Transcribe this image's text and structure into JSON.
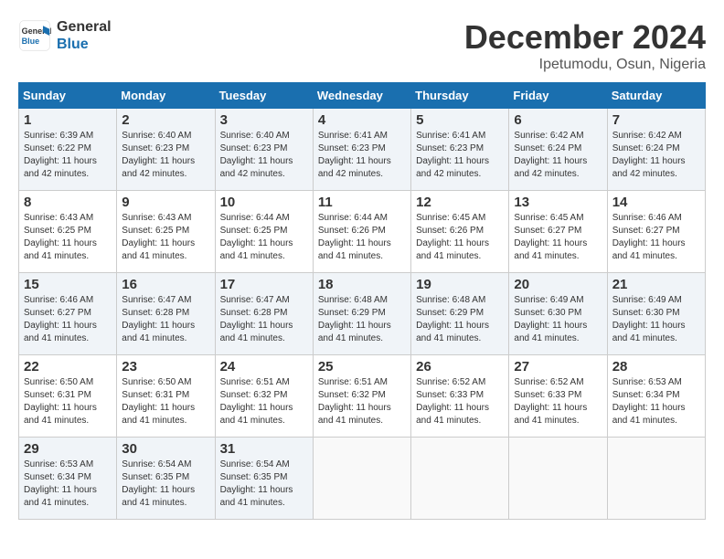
{
  "header": {
    "logo_line1": "General",
    "logo_line2": "Blue",
    "month": "December 2024",
    "location": "Ipetumodu, Osun, Nigeria"
  },
  "days_of_week": [
    "Sunday",
    "Monday",
    "Tuesday",
    "Wednesday",
    "Thursday",
    "Friday",
    "Saturday"
  ],
  "weeks": [
    [
      {
        "day": "1",
        "info": "Sunrise: 6:39 AM\nSunset: 6:22 PM\nDaylight: 11 hours\nand 42 minutes."
      },
      {
        "day": "2",
        "info": "Sunrise: 6:40 AM\nSunset: 6:23 PM\nDaylight: 11 hours\nand 42 minutes."
      },
      {
        "day": "3",
        "info": "Sunrise: 6:40 AM\nSunset: 6:23 PM\nDaylight: 11 hours\nand 42 minutes."
      },
      {
        "day": "4",
        "info": "Sunrise: 6:41 AM\nSunset: 6:23 PM\nDaylight: 11 hours\nand 42 minutes."
      },
      {
        "day": "5",
        "info": "Sunrise: 6:41 AM\nSunset: 6:23 PM\nDaylight: 11 hours\nand 42 minutes."
      },
      {
        "day": "6",
        "info": "Sunrise: 6:42 AM\nSunset: 6:24 PM\nDaylight: 11 hours\nand 42 minutes."
      },
      {
        "day": "7",
        "info": "Sunrise: 6:42 AM\nSunset: 6:24 PM\nDaylight: 11 hours\nand 42 minutes."
      }
    ],
    [
      {
        "day": "8",
        "info": "Sunrise: 6:43 AM\nSunset: 6:25 PM\nDaylight: 11 hours\nand 41 minutes."
      },
      {
        "day": "9",
        "info": "Sunrise: 6:43 AM\nSunset: 6:25 PM\nDaylight: 11 hours\nand 41 minutes."
      },
      {
        "day": "10",
        "info": "Sunrise: 6:44 AM\nSunset: 6:25 PM\nDaylight: 11 hours\nand 41 minutes."
      },
      {
        "day": "11",
        "info": "Sunrise: 6:44 AM\nSunset: 6:26 PM\nDaylight: 11 hours\nand 41 minutes."
      },
      {
        "day": "12",
        "info": "Sunrise: 6:45 AM\nSunset: 6:26 PM\nDaylight: 11 hours\nand 41 minutes."
      },
      {
        "day": "13",
        "info": "Sunrise: 6:45 AM\nSunset: 6:27 PM\nDaylight: 11 hours\nand 41 minutes."
      },
      {
        "day": "14",
        "info": "Sunrise: 6:46 AM\nSunset: 6:27 PM\nDaylight: 11 hours\nand 41 minutes."
      }
    ],
    [
      {
        "day": "15",
        "info": "Sunrise: 6:46 AM\nSunset: 6:27 PM\nDaylight: 11 hours\nand 41 minutes."
      },
      {
        "day": "16",
        "info": "Sunrise: 6:47 AM\nSunset: 6:28 PM\nDaylight: 11 hours\nand 41 minutes."
      },
      {
        "day": "17",
        "info": "Sunrise: 6:47 AM\nSunset: 6:28 PM\nDaylight: 11 hours\nand 41 minutes."
      },
      {
        "day": "18",
        "info": "Sunrise: 6:48 AM\nSunset: 6:29 PM\nDaylight: 11 hours\nand 41 minutes."
      },
      {
        "day": "19",
        "info": "Sunrise: 6:48 AM\nSunset: 6:29 PM\nDaylight: 11 hours\nand 41 minutes."
      },
      {
        "day": "20",
        "info": "Sunrise: 6:49 AM\nSunset: 6:30 PM\nDaylight: 11 hours\nand 41 minutes."
      },
      {
        "day": "21",
        "info": "Sunrise: 6:49 AM\nSunset: 6:30 PM\nDaylight: 11 hours\nand 41 minutes."
      }
    ],
    [
      {
        "day": "22",
        "info": "Sunrise: 6:50 AM\nSunset: 6:31 PM\nDaylight: 11 hours\nand 41 minutes."
      },
      {
        "day": "23",
        "info": "Sunrise: 6:50 AM\nSunset: 6:31 PM\nDaylight: 11 hours\nand 41 minutes."
      },
      {
        "day": "24",
        "info": "Sunrise: 6:51 AM\nSunset: 6:32 PM\nDaylight: 11 hours\nand 41 minutes."
      },
      {
        "day": "25",
        "info": "Sunrise: 6:51 AM\nSunset: 6:32 PM\nDaylight: 11 hours\nand 41 minutes."
      },
      {
        "day": "26",
        "info": "Sunrise: 6:52 AM\nSunset: 6:33 PM\nDaylight: 11 hours\nand 41 minutes."
      },
      {
        "day": "27",
        "info": "Sunrise: 6:52 AM\nSunset: 6:33 PM\nDaylight: 11 hours\nand 41 minutes."
      },
      {
        "day": "28",
        "info": "Sunrise: 6:53 AM\nSunset: 6:34 PM\nDaylight: 11 hours\nand 41 minutes."
      }
    ],
    [
      {
        "day": "29",
        "info": "Sunrise: 6:53 AM\nSunset: 6:34 PM\nDaylight: 11 hours\nand 41 minutes."
      },
      {
        "day": "30",
        "info": "Sunrise: 6:54 AM\nSunset: 6:35 PM\nDaylight: 11 hours\nand 41 minutes."
      },
      {
        "day": "31",
        "info": "Sunrise: 6:54 AM\nSunset: 6:35 PM\nDaylight: 11 hours\nand 41 minutes."
      },
      {
        "day": "",
        "info": ""
      },
      {
        "day": "",
        "info": ""
      },
      {
        "day": "",
        "info": ""
      },
      {
        "day": "",
        "info": ""
      }
    ]
  ]
}
